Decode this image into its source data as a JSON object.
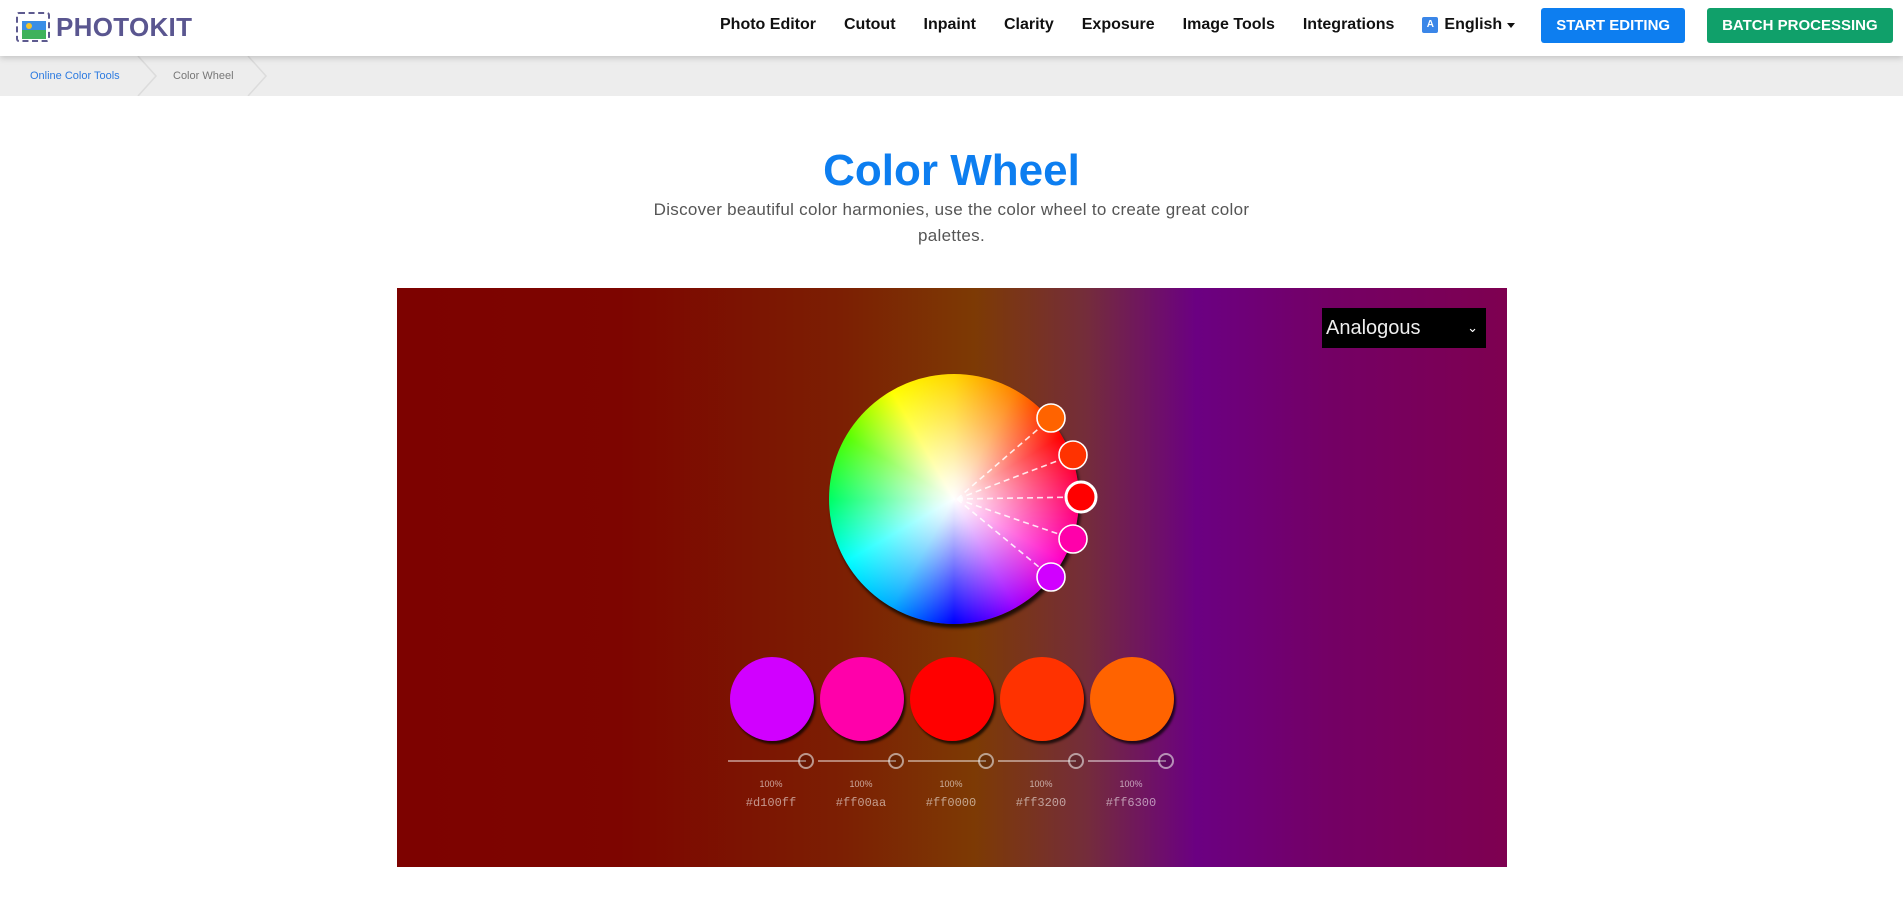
{
  "brand": {
    "name": "PHOTOKIT"
  },
  "nav": {
    "items": [
      "Photo Editor",
      "Cutout",
      "Inpaint",
      "Clarity",
      "Exposure",
      "Image Tools",
      "Integrations"
    ],
    "language": "English",
    "start_editing": "START EDITING",
    "batch_processing": "BATCH PROCESSING"
  },
  "breadcrumb": [
    "Online Color Tools",
    "Color Wheel"
  ],
  "hero": {
    "title": "Color Wheel",
    "subtitle": "Discover beautiful color harmonies, use the color wheel to create great color palettes."
  },
  "tool": {
    "harmony_mode": "Analogous",
    "base_color": "#ff0000",
    "palette": [
      {
        "hex": "#d100ff",
        "brightness": "100%",
        "color": "#d100ff"
      },
      {
        "hex": "#ff00aa",
        "brightness": "100%",
        "color": "#ff00aa"
      },
      {
        "hex": "#ff0000",
        "brightness": "100%",
        "color": "#ff0000"
      },
      {
        "hex": "#ff3200",
        "brightness": "100%",
        "color": "#ff3200"
      },
      {
        "hex": "#ff6300",
        "brightness": "100%",
        "color": "#ff6300"
      }
    ]
  },
  "colors": {
    "brand_blue": "#0d7ef0",
    "brand_green": "#10a06a",
    "brand_text": "#5a5690"
  }
}
